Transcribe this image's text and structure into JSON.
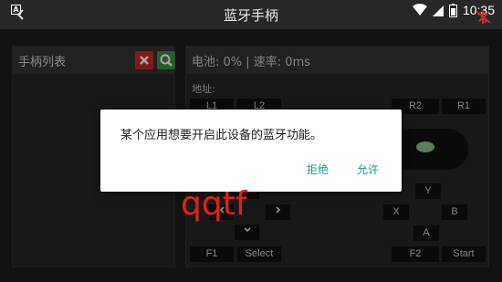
{
  "statusbar": {
    "title": "蓝牙手柄",
    "time": "10:35",
    "notification_letter": "A"
  },
  "left_panel": {
    "title": "手柄列表"
  },
  "right_panel": {
    "info": "电池: 0% | 速率: 0ms",
    "address_label": "地址:"
  },
  "keys": {
    "l1": "L1",
    "l2": "L2",
    "r1": "R1",
    "r2": "R2",
    "y": "Y",
    "x": "X",
    "b": "B",
    "a": "A",
    "f1": "F1",
    "select": "Select",
    "f2": "F2",
    "start": "Start"
  },
  "dialog": {
    "message": "某个应用想要开启此设备的蓝牙功能。",
    "deny": "拒绝",
    "allow": "允许"
  },
  "overlay_text": "qqtf",
  "colors": {
    "accent": "#139a8c",
    "danger": "#c72b2b",
    "ok": "#3d8c3d",
    "scribble": "#e0201c"
  }
}
